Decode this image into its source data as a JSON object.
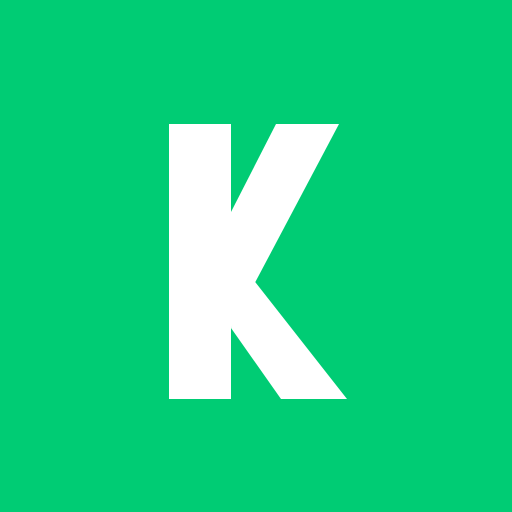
{
  "app_icon": {
    "letter": "K",
    "icon": "letter-k-logo-icon",
    "colors": {
      "background": "#00CC74",
      "foreground": "#FFFFFF"
    }
  }
}
